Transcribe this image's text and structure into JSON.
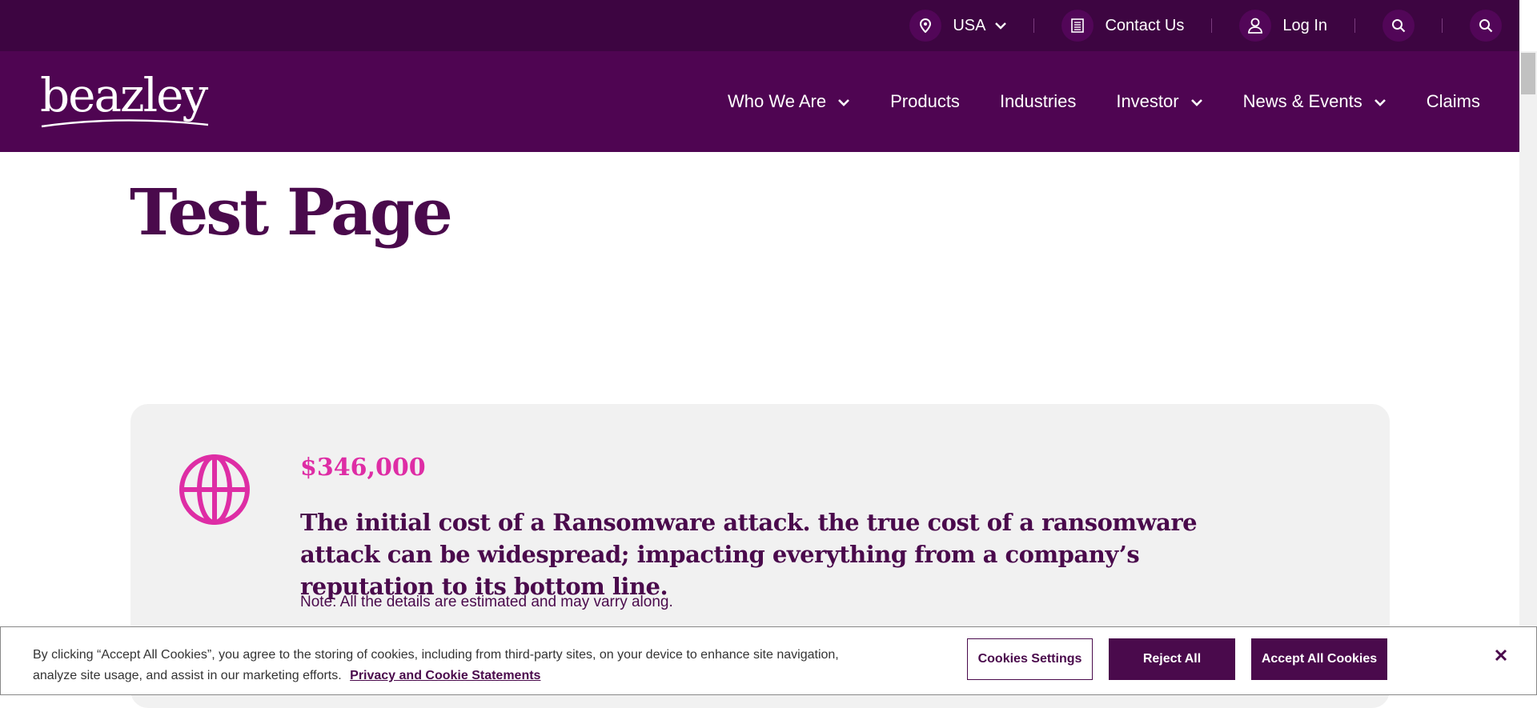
{
  "utility_bar": {
    "region": "USA",
    "contact": "Contact Us",
    "login": "Log In"
  },
  "brand": {
    "logo_text": "beazley"
  },
  "nav": {
    "items": [
      {
        "label": "Who We Are",
        "has_dropdown": true
      },
      {
        "label": "Products",
        "has_dropdown": false
      },
      {
        "label": "Industries",
        "has_dropdown": false
      },
      {
        "label": "Investor",
        "has_dropdown": true
      },
      {
        "label": "News & Events",
        "has_dropdown": true
      },
      {
        "label": "Claims",
        "has_dropdown": false
      }
    ]
  },
  "page": {
    "title": "Test Page"
  },
  "stat_card": {
    "icon": "globe-icon",
    "value": "$346,000",
    "description": "The initial cost of a Ransomware attack. the true cost of a ransomware attack can be widespread; impacting everything from a company’s reputation to its bottom line.",
    "note": "Note: All the details are estimated and may varry along."
  },
  "cookie_banner": {
    "text": "By clicking “Accept All Cookies”, you agree to the storing of cookies, including from third-party sites, on your device to enhance site navigation, analyze site usage, and assist in our marketing efforts.",
    "link": "Privacy and Cookie Statements",
    "settings_label": "Cookies Settings",
    "reject_label": "Reject All",
    "accept_label": "Accept All Cookies"
  },
  "colors": {
    "utility_bg": "#3d0541",
    "nav_bg": "#4f0552",
    "brand_purple": "#4a0a4c",
    "accent_pink": "#de2da5",
    "card_bg": "#f1f1f1"
  }
}
